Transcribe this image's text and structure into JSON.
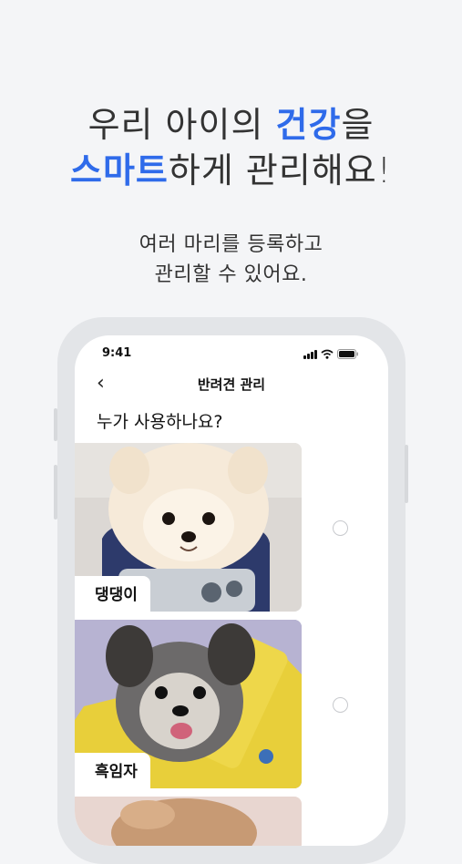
{
  "headline": {
    "line1_pre": "우리 아이의 ",
    "line1_accent": "건강",
    "line1_post": "을",
    "line2_accent": "스마트",
    "line2_post": "하게 관리해요!"
  },
  "subline": {
    "line1": "여러 마리를 등록하고",
    "line2": "관리할 수 있어요."
  },
  "phone": {
    "time": "9:41",
    "nav_title": "반려견 관리",
    "question": "누가 사용하나요?",
    "pets": [
      {
        "name": "댕댕이",
        "selected": false
      },
      {
        "name": "흑임자",
        "selected": false
      }
    ]
  },
  "colors": {
    "accent": "#2f6bea",
    "background": "#f4f5f7"
  }
}
